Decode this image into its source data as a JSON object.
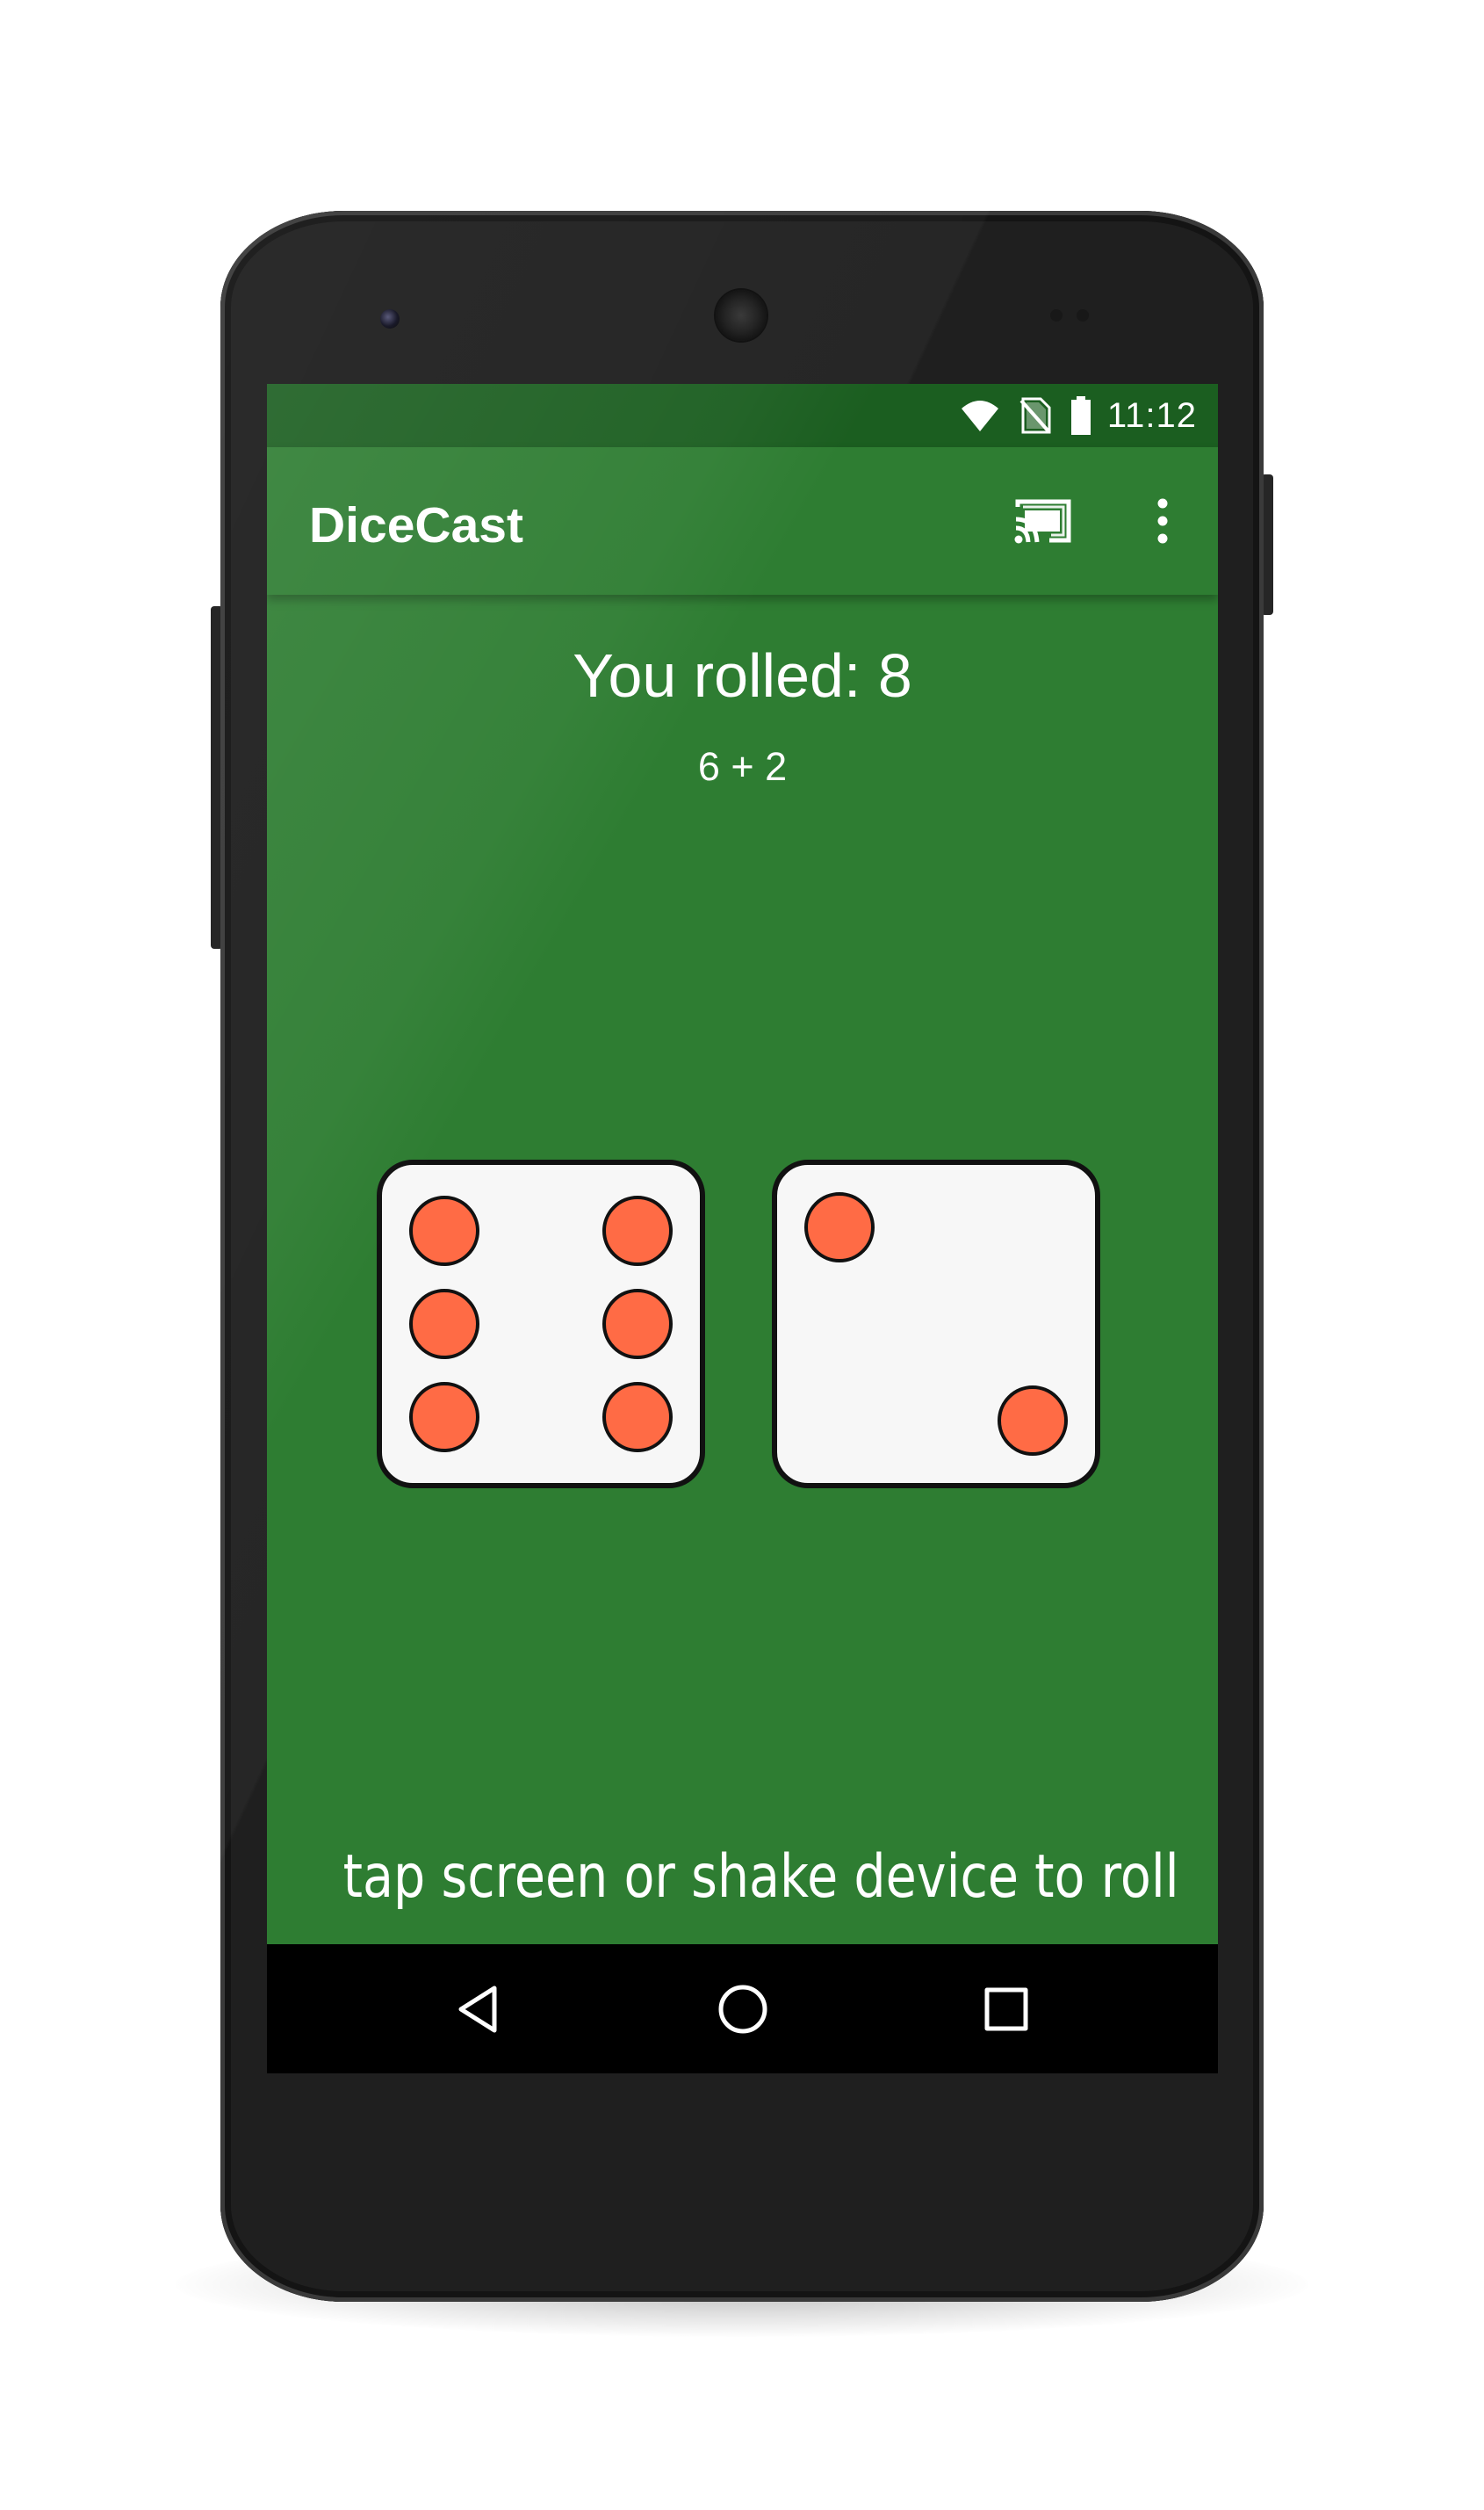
{
  "status_bar": {
    "time": "11:12",
    "icons": [
      "wifi-icon",
      "no-sim-icon",
      "battery-icon"
    ]
  },
  "app_bar": {
    "title": "DiceCast",
    "actions": [
      "cast-icon",
      "overflow-menu-icon"
    ]
  },
  "roll": {
    "result_text": "You rolled: 8",
    "breakdown_text": "6 + 2",
    "dice": [
      {
        "value": 6
      },
      {
        "value": 2
      }
    ]
  },
  "instruction": "tap screen or shake device to roll",
  "nav_bar": {
    "buttons": [
      "back-icon",
      "home-icon",
      "recents-icon"
    ]
  },
  "colors": {
    "screen_background": "#2e7d32",
    "status_bar": "#1b5e20",
    "die_face": "#f7f7f7",
    "die_outline": "#111111",
    "pip": "#ff6b45",
    "nav_bar": "#000000"
  }
}
